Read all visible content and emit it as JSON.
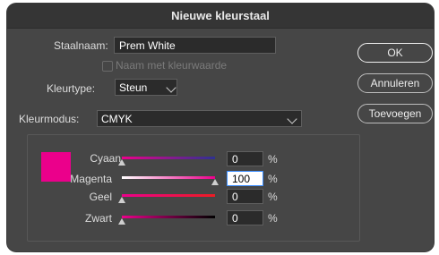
{
  "dialog": {
    "title": "Nieuwe kleurstaal"
  },
  "swatch_name": {
    "label": "Staalnaam:",
    "value": "Prem White"
  },
  "name_with_color_value": {
    "label": "Naam met kleurwaarde",
    "checked": false,
    "enabled": false
  },
  "color_type": {
    "label": "Kleurtype:",
    "value": "Steun"
  },
  "color_mode": {
    "label": "Kleurmodus:",
    "value": "CMYK"
  },
  "buttons": {
    "ok": "OK",
    "cancel": "Annuleren",
    "add": "Toevoegen"
  },
  "swatch_color": "#eb008b",
  "sliders": [
    {
      "label": "Cyaan",
      "value": "0",
      "unit": "%",
      "percent": 0,
      "track_start": "#eb008b",
      "track_end": "#2e3192"
    },
    {
      "label": "Magenta",
      "value": "100",
      "unit": "%",
      "percent": 100,
      "track_start": "#ffffff",
      "track_end": "#eb008b"
    },
    {
      "label": "Geel",
      "value": "0",
      "unit": "%",
      "percent": 0,
      "track_start": "#eb008b",
      "track_end": "#ed1c24"
    },
    {
      "label": "Zwart",
      "value": "0",
      "unit": "%",
      "percent": 0,
      "track_start": "#eb008b",
      "track_end": "#000000"
    }
  ]
}
